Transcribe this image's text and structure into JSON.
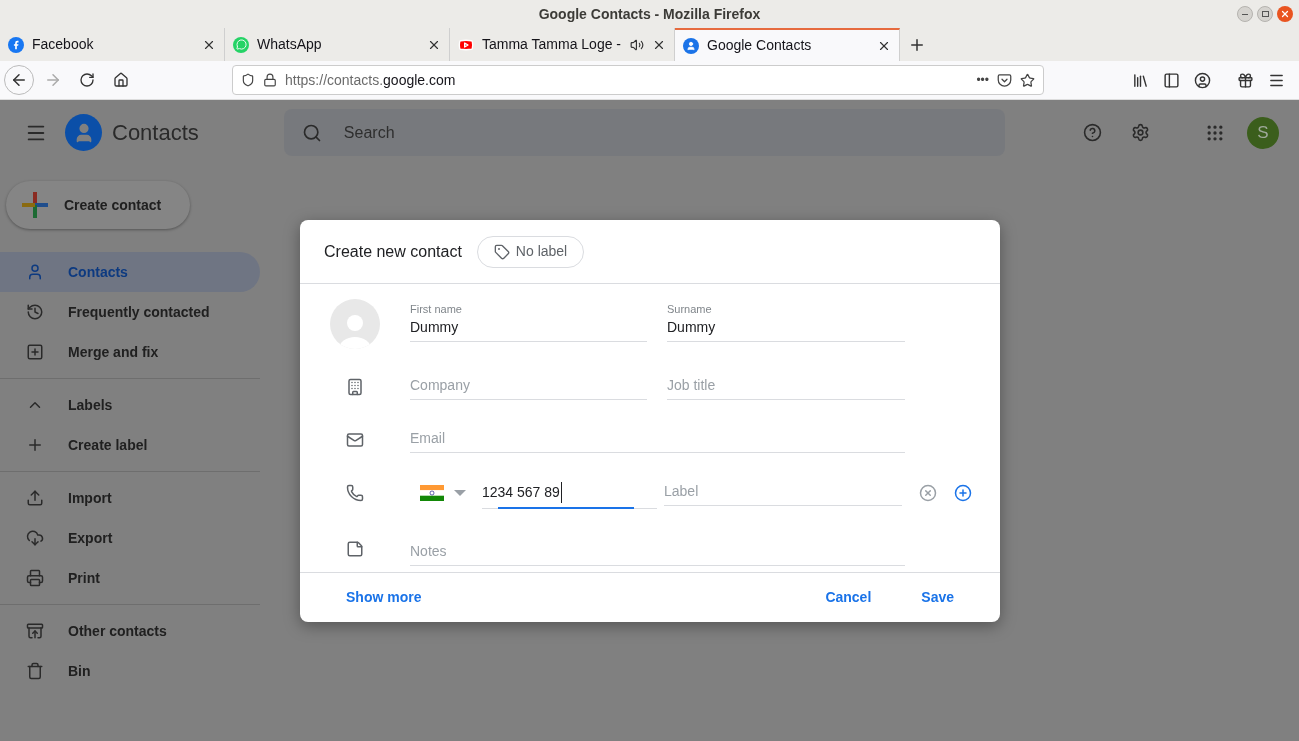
{
  "window": {
    "title": "Google Contacts - Mozilla Firefox"
  },
  "tabs": [
    {
      "label": "Facebook",
      "selected": false,
      "audio": false
    },
    {
      "label": "WhatsApp",
      "selected": false,
      "audio": false
    },
    {
      "label": "Tamma Tamma Loge -",
      "selected": false,
      "audio": true
    },
    {
      "label": "Google Contacts",
      "selected": true,
      "audio": false
    }
  ],
  "address_bar": {
    "url_prefix": "https://contacts.",
    "url_domain": "google.com",
    "more": "•••"
  },
  "app_header": {
    "title": "Contacts",
    "search": {
      "placeholder": "Search"
    },
    "avatar": "S"
  },
  "create_button": "Create contact",
  "sidebar": {
    "groups": [
      [
        {
          "label": "Contacts",
          "selected": true
        },
        {
          "label": "Frequently contacted",
          "selected": false
        },
        {
          "label": "Merge and fix",
          "selected": false
        }
      ],
      [
        {
          "label": "Labels",
          "selected": false
        },
        {
          "label": "Create label",
          "selected": false
        }
      ],
      [
        {
          "label": "Import",
          "selected": false
        },
        {
          "label": "Export",
          "selected": false
        },
        {
          "label": "Print",
          "selected": false
        }
      ],
      [
        {
          "label": "Other contacts",
          "selected": false
        },
        {
          "label": "Bin",
          "selected": false
        }
      ]
    ]
  },
  "dialog": {
    "title": "Create new contact",
    "label_chip": "No label",
    "first_name": {
      "label": "First name",
      "value": "Dummy"
    },
    "surname": {
      "label": "Surname",
      "value": "Dummy"
    },
    "company": {
      "placeholder": "Company"
    },
    "job_title": {
      "placeholder": "Job title"
    },
    "email": {
      "placeholder": "Email"
    },
    "phone": {
      "value": "1234 567 89",
      "focused": true
    },
    "phone_label": {
      "placeholder": "Label"
    },
    "notes": {
      "placeholder": "Notes"
    },
    "show_more": "Show more",
    "cancel": "Cancel",
    "save": "Save"
  }
}
